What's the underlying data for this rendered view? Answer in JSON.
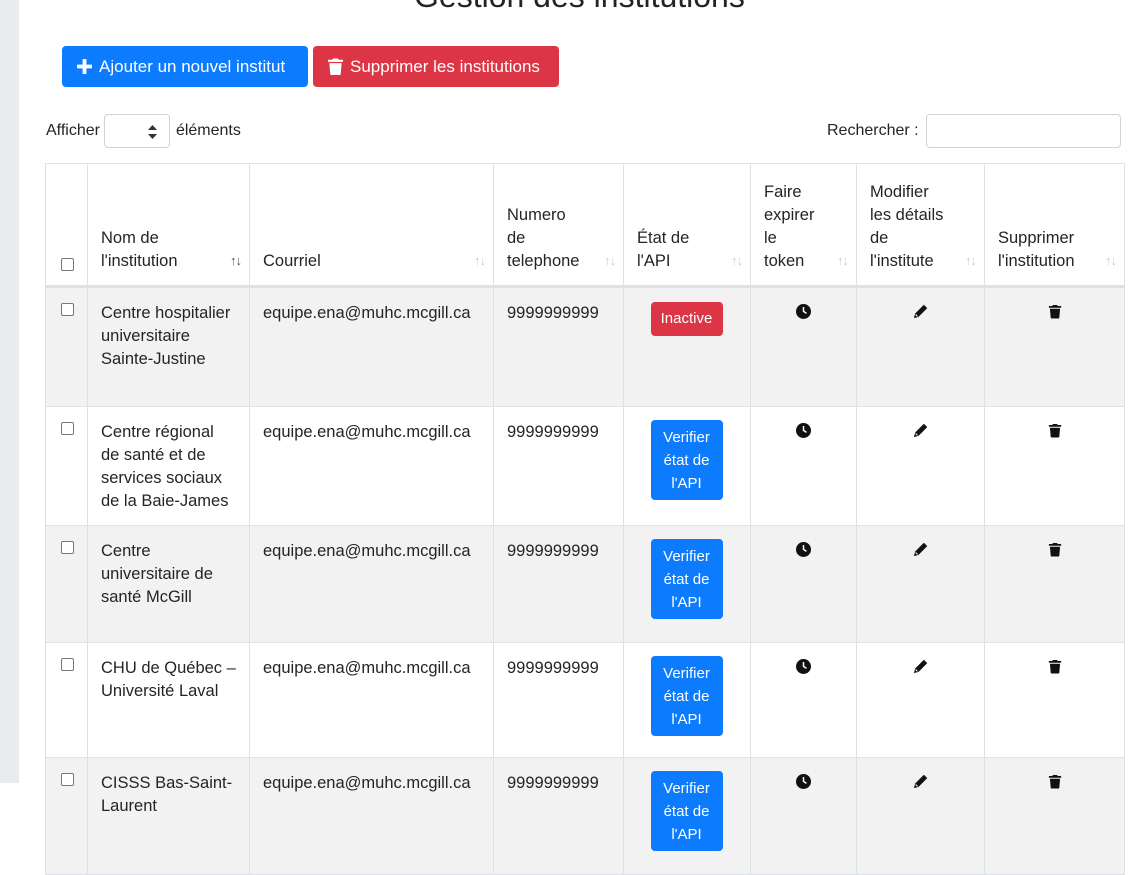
{
  "page": {
    "title": "Gestion des institutions"
  },
  "toolbar": {
    "add_label": "Ajouter un nouvel institut",
    "delete_label": "Supprimer les institutions",
    "add_color": "#0d7bfd",
    "delete_color": "#dc3545"
  },
  "table_controls": {
    "show_label": "Afficher",
    "show_suffix": "éléments",
    "search_label": "Rechercher :",
    "search_value": ""
  },
  "table": {
    "headers": [
      "Nom de l'institution",
      "Courriel",
      "Numero de telephone",
      "État de l'API",
      "Faire expirer le token",
      "Modifier les détails de l'institute",
      "Supprimer l'institution"
    ],
    "rows": [
      {
        "name": "Centre hospitalier universitaire Sainte-Justine",
        "email": "equipe.ena@muhc.mcgill.ca",
        "phone": "9999999999",
        "state": "Inactive"
      },
      {
        "name": "Centre régional de santé et de services sociaux de la Baie-James",
        "email": "equipe.ena@muhc.mcgill.ca",
        "phone": "9999999999",
        "state": "Verifier état de l'API"
      },
      {
        "name": "Centre universitaire de santé McGill",
        "email": "equipe.ena@muhc.mcgill.ca",
        "phone": "9999999999",
        "state": "Verifier état de l'API"
      },
      {
        "name": "CHU de Québec – Université Laval",
        "email": "equipe.ena@muhc.mcgill.ca",
        "phone": "9999999999",
        "state": "Verifier état de l'API"
      },
      {
        "name": "CISSS Bas-Saint-Laurent",
        "email": "equipe.ena@muhc.mcgill.ca",
        "phone": "9999999999",
        "state": "Verifier état de l'API"
      }
    ],
    "icons": {
      "expire": "clock-icon",
      "edit": "pencil-icon",
      "delete": "trash-icon"
    },
    "colors": {
      "inactive_badge": "#dc3545",
      "verify_button": "#0d7bfd",
      "striped_row": "#f2f2f2"
    }
  }
}
